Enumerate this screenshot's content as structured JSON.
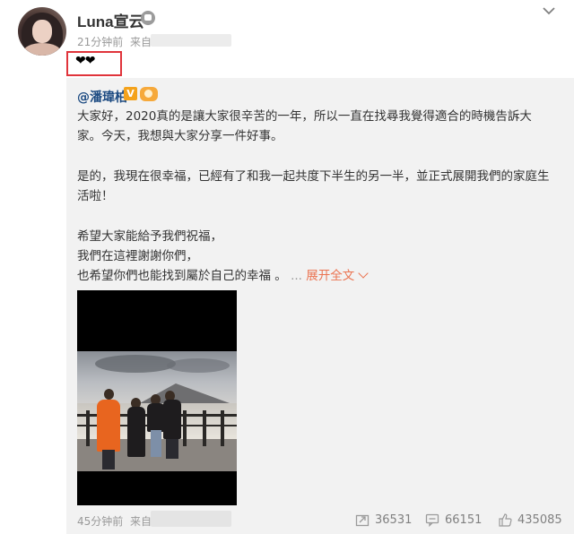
{
  "post": {
    "username": "Luna宣云",
    "time": "21分钟前",
    "source_prefix": "来自",
    "content": "❤❤"
  },
  "repost": {
    "mention": "@潘瑋柏",
    "badge": "V",
    "paragraph1": "大家好，2020真的是讓大家很辛苦的一年，所以一直在找尋我覺得適合的時機告訴大家。今天，我想與大家分享一件好事。",
    "paragraph2": "是的，我現在很幸福，已經有了和我一起共度下半生的另一半，並正式展開我們的家庭生活啦！",
    "line3a": "希望大家能給予我們祝福，",
    "line3b": "我們在這裡謝謝你們，",
    "line3c": "也希望你們也能找到屬於自己的幸福 。",
    "ellipsis": "...",
    "expand_label": "展开全文",
    "time": "45分钟前",
    "source_prefix": "来自",
    "forward_count": "36531",
    "comment_count": "66151",
    "like_count": "435085"
  },
  "colors": {
    "highlight_border": "#e0343b",
    "link": "#1d4b82",
    "expand": "#eb7350",
    "repost_bg": "#f2f2f2"
  },
  "icons": [
    "chevron-down-icon",
    "vip-icon",
    "crown-icon",
    "forward-icon",
    "comment-icon",
    "like-icon"
  ]
}
